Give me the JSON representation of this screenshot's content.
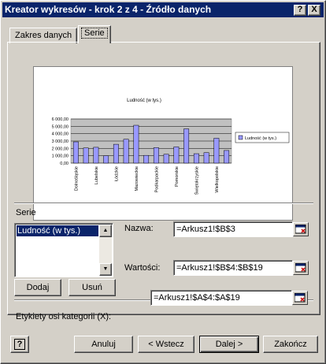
{
  "window": {
    "title": "Kreator wykresów - krok 2 z 4 - Źródło danych",
    "help_button": "?",
    "close_button": "X"
  },
  "tabs": [
    {
      "label": "Zakres danych",
      "active": false
    },
    {
      "label": "Serie",
      "active": true
    }
  ],
  "chart_data": {
    "type": "bar",
    "title": "Ludność (w tys.)",
    "legend": [
      "Ludność (w tys.)"
    ],
    "legend_position": "right",
    "grid": true,
    "yticks": [
      "6 000,00",
      "5 000,00",
      "4 000,00",
      "3 000,00",
      "2 000,00",
      "1 000,00",
      "0,00"
    ],
    "ylim": [
      0,
      6000
    ],
    "categories": [
      "Dolnośląskie",
      "",
      "Lubelskie",
      "",
      "Łódzkie",
      "",
      "Mazowieckie",
      "",
      "Podkarpackie",
      "",
      "Pomorskie",
      "",
      "Świętokrzyskie",
      "",
      "Wielkopolskie",
      ""
    ],
    "values": [
      2890,
      2060,
      2150,
      1000,
      2560,
      3240,
      5140,
      1050,
      2100,
      1200,
      2200,
      4650,
      1280,
      1420,
      3380,
      1720
    ],
    "colors": {
      "bar": "#9999ff",
      "plot_bg": "#c0c0c0"
    }
  },
  "series": {
    "group_label": "Serie",
    "items": [
      "Ludność (w tys.)"
    ]
  },
  "fields": {
    "name_label": "Nazwa:",
    "name_value": "=Arkusz1!$B$3",
    "values_label": "Wartości:",
    "values_value": "=Arkusz1!$B$4:$B$19",
    "category_label": "Etykiety osi kategorii (X):",
    "category_value": "=Arkusz1!$A$4:$A$19"
  },
  "buttons": {
    "add": "Dodaj",
    "remove": "Usuń",
    "help": "?",
    "cancel": "Anuluj",
    "back": "< Wstecz",
    "next": "Dalej >",
    "finish": "Zakończ"
  }
}
